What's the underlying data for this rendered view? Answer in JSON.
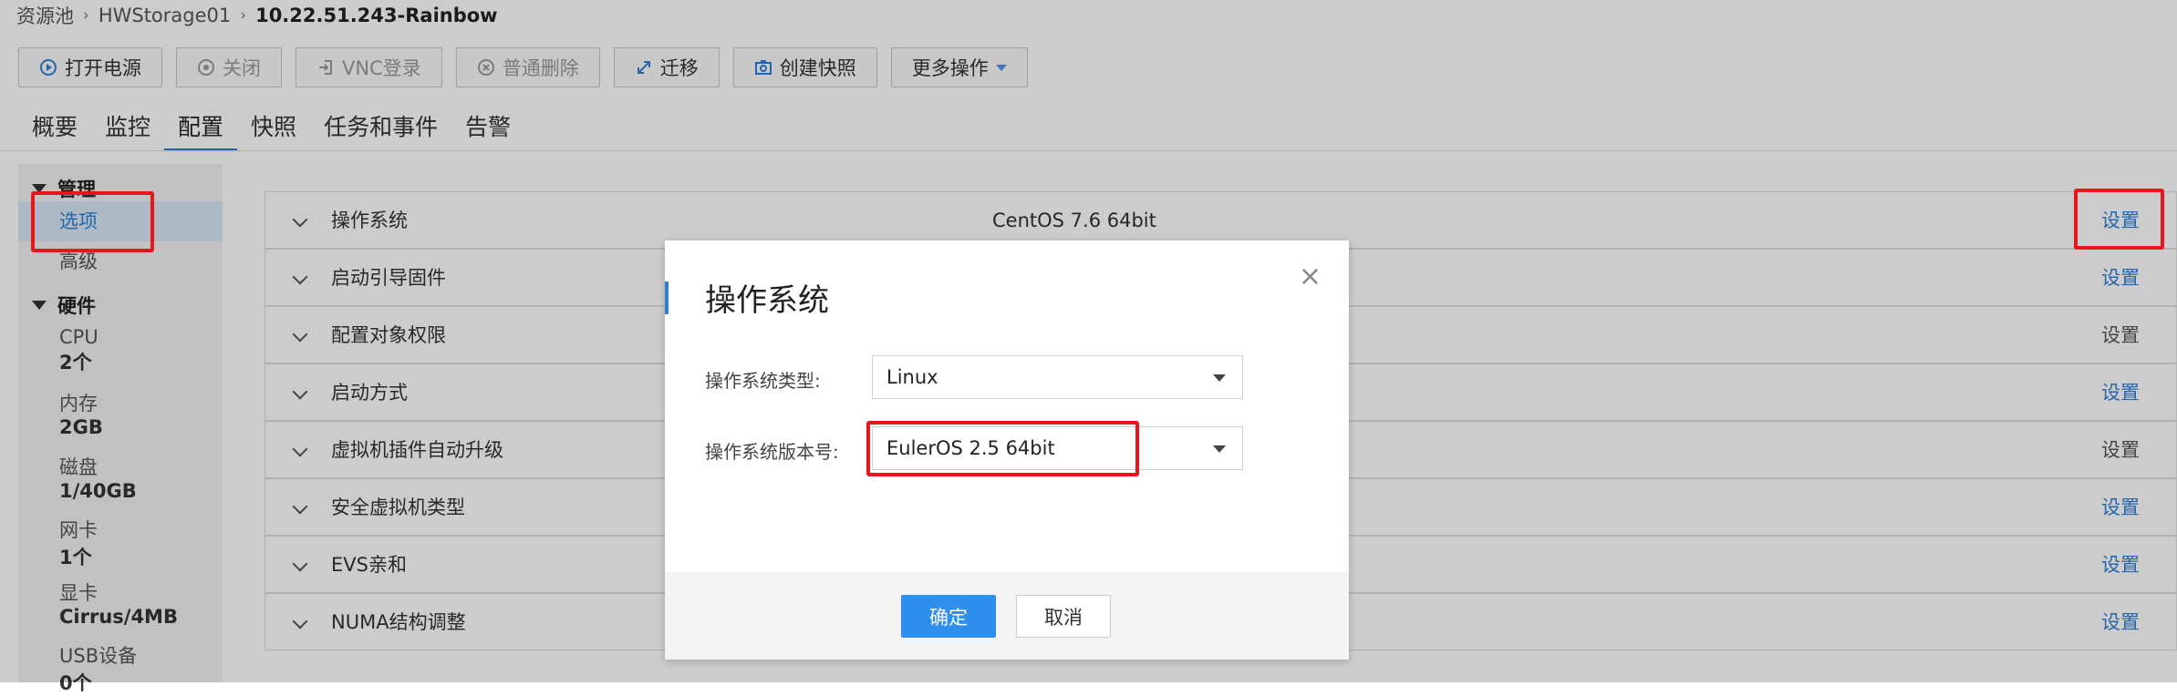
{
  "breadcrumb": [
    "资源池",
    "HWStorage01",
    "10.22.51.243-Rainbow"
  ],
  "toolbar": {
    "power_on": "打开电源",
    "shutdown": "关闭",
    "vnc": "VNC登录",
    "delete": "普通删除",
    "migrate": "迁移",
    "snapshot": "创建快照",
    "more": "更多操作"
  },
  "tabs": [
    "概要",
    "监控",
    "配置",
    "快照",
    "任务和事件",
    "告警"
  ],
  "active_tab": "配置",
  "left_panel": {
    "manage_title": "管理",
    "manage_items": [
      "选项",
      "高级"
    ],
    "hardware_title": "硬件",
    "hardware_items": [
      {
        "label": "CPU",
        "value": "2个"
      },
      {
        "label": "内存",
        "value": "2GB"
      },
      {
        "label": "磁盘",
        "value": "1/40GB"
      },
      {
        "label": "网卡",
        "value": "1个"
      },
      {
        "label": "显卡",
        "value": "Cirrus/4MB"
      },
      {
        "label": "USB设备",
        "value": "0个"
      }
    ]
  },
  "config_rows": [
    {
      "name": "操作系统",
      "value": "CentOS 7.6 64bit",
      "action": "设置"
    },
    {
      "name": "启动引导固件",
      "value": "",
      "action": "设置"
    },
    {
      "name": "配置对象权限",
      "value": "",
      "action": "设置"
    },
    {
      "name": "启动方式",
      "value": "",
      "action": "设置"
    },
    {
      "name": "虚拟机插件自动升级",
      "value": "",
      "action": "设置"
    },
    {
      "name": "安全虚拟机类型",
      "value": "",
      "action": "设置"
    },
    {
      "name": "EVS亲和",
      "value": "",
      "action": "设置"
    },
    {
      "name": "NUMA结构调整",
      "value": "",
      "action": "设置"
    }
  ],
  "dialog": {
    "title": "操作系统",
    "close": "×",
    "os_type_label": "操作系统类型:",
    "os_type_value": "Linux",
    "os_version_label": "操作系统版本号:",
    "os_version_value": "EulerOS 2.5 64bit",
    "ok": "确定",
    "cancel": "取消"
  },
  "colors": {
    "accent": "#2f7fd8",
    "highlight": "#e8161c",
    "ok_button": "#2f8fec"
  }
}
